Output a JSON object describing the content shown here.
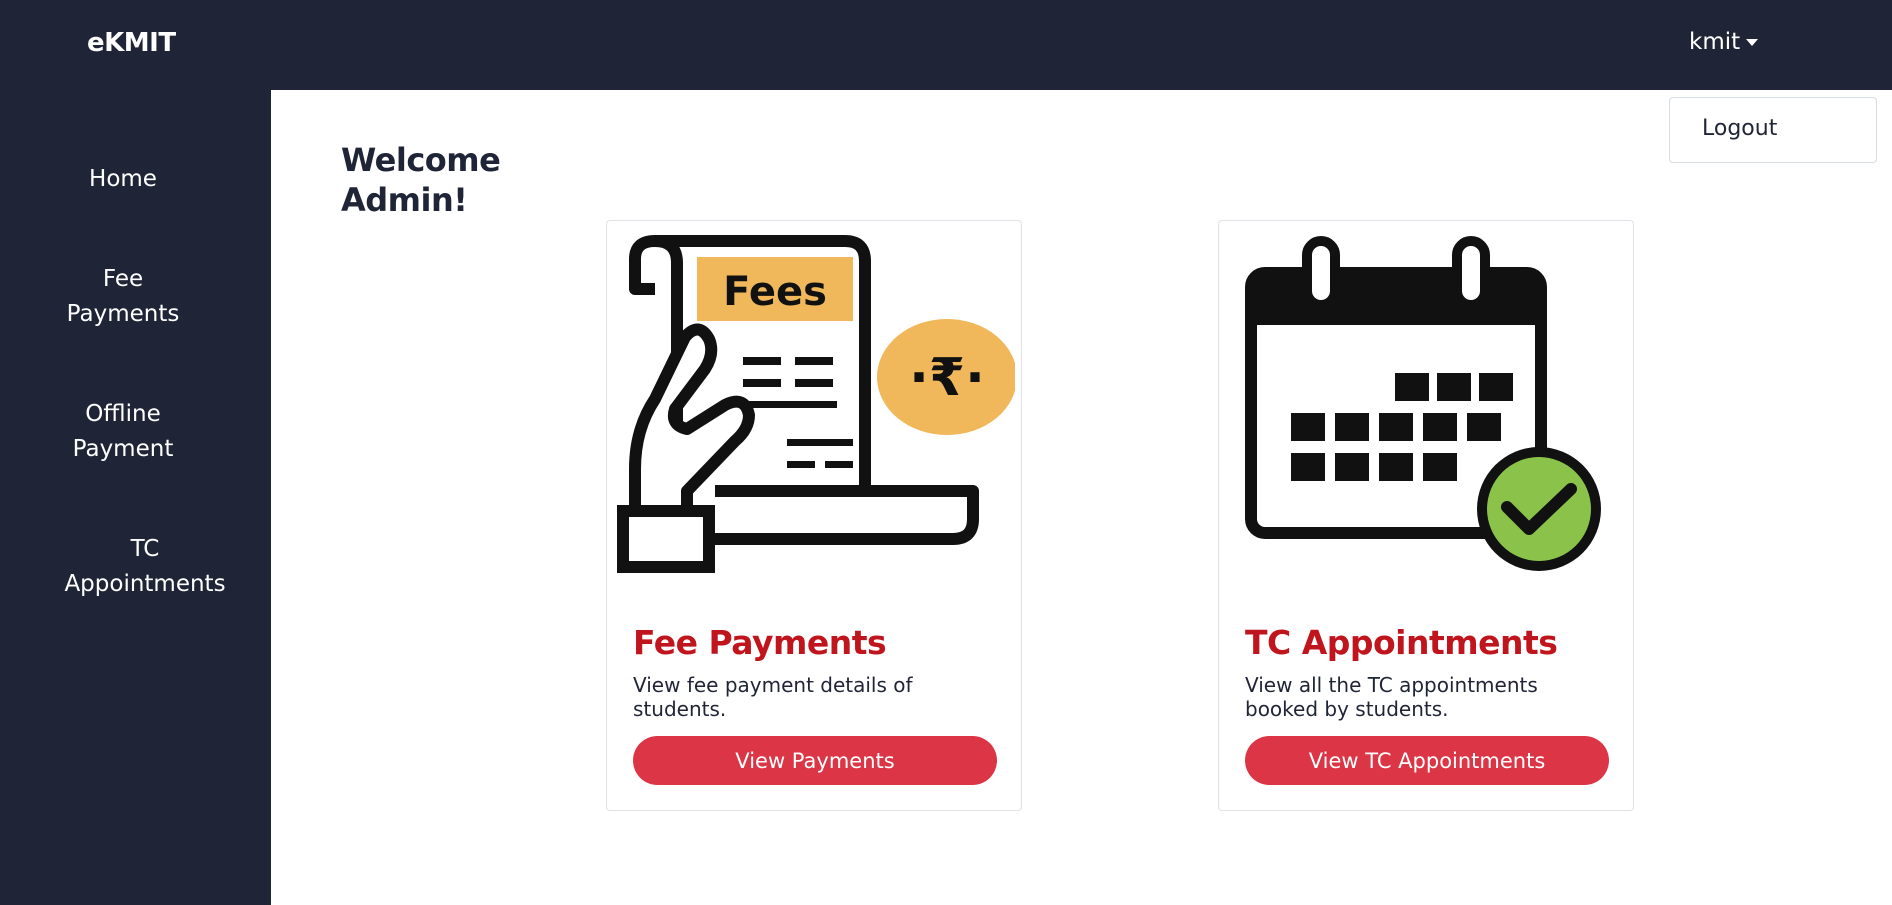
{
  "app": {
    "brand": "eKMIT"
  },
  "header": {
    "user_label": "kmit"
  },
  "user_menu": {
    "items": [
      {
        "label": "Logout"
      }
    ]
  },
  "sidebar": {
    "items": [
      {
        "label": "Home"
      },
      {
        "label": "Fee Payments"
      },
      {
        "label": "Offline Payment"
      },
      {
        "label": "TC Appointments"
      }
    ]
  },
  "main": {
    "welcome": "Welcome Admin!",
    "cards": [
      {
        "title": "Fee Payments",
        "text": "View fee payment details of students.",
        "button": "View Payments",
        "image_label": "Fees",
        "image_symbol": "·₹·",
        "icon": "fee-document-rupee-icon"
      },
      {
        "title": "TC Appointments",
        "text": "View all the TC appointments booked by students.",
        "button": "View TC Appointments",
        "icon": "calendar-check-icon"
      }
    ]
  },
  "colors": {
    "navy": "#1f2537",
    "title_red": "#c0151d",
    "button_red": "#dc3545",
    "fees_yellow": "#f0b85a",
    "check_green": "#8bc34a"
  }
}
